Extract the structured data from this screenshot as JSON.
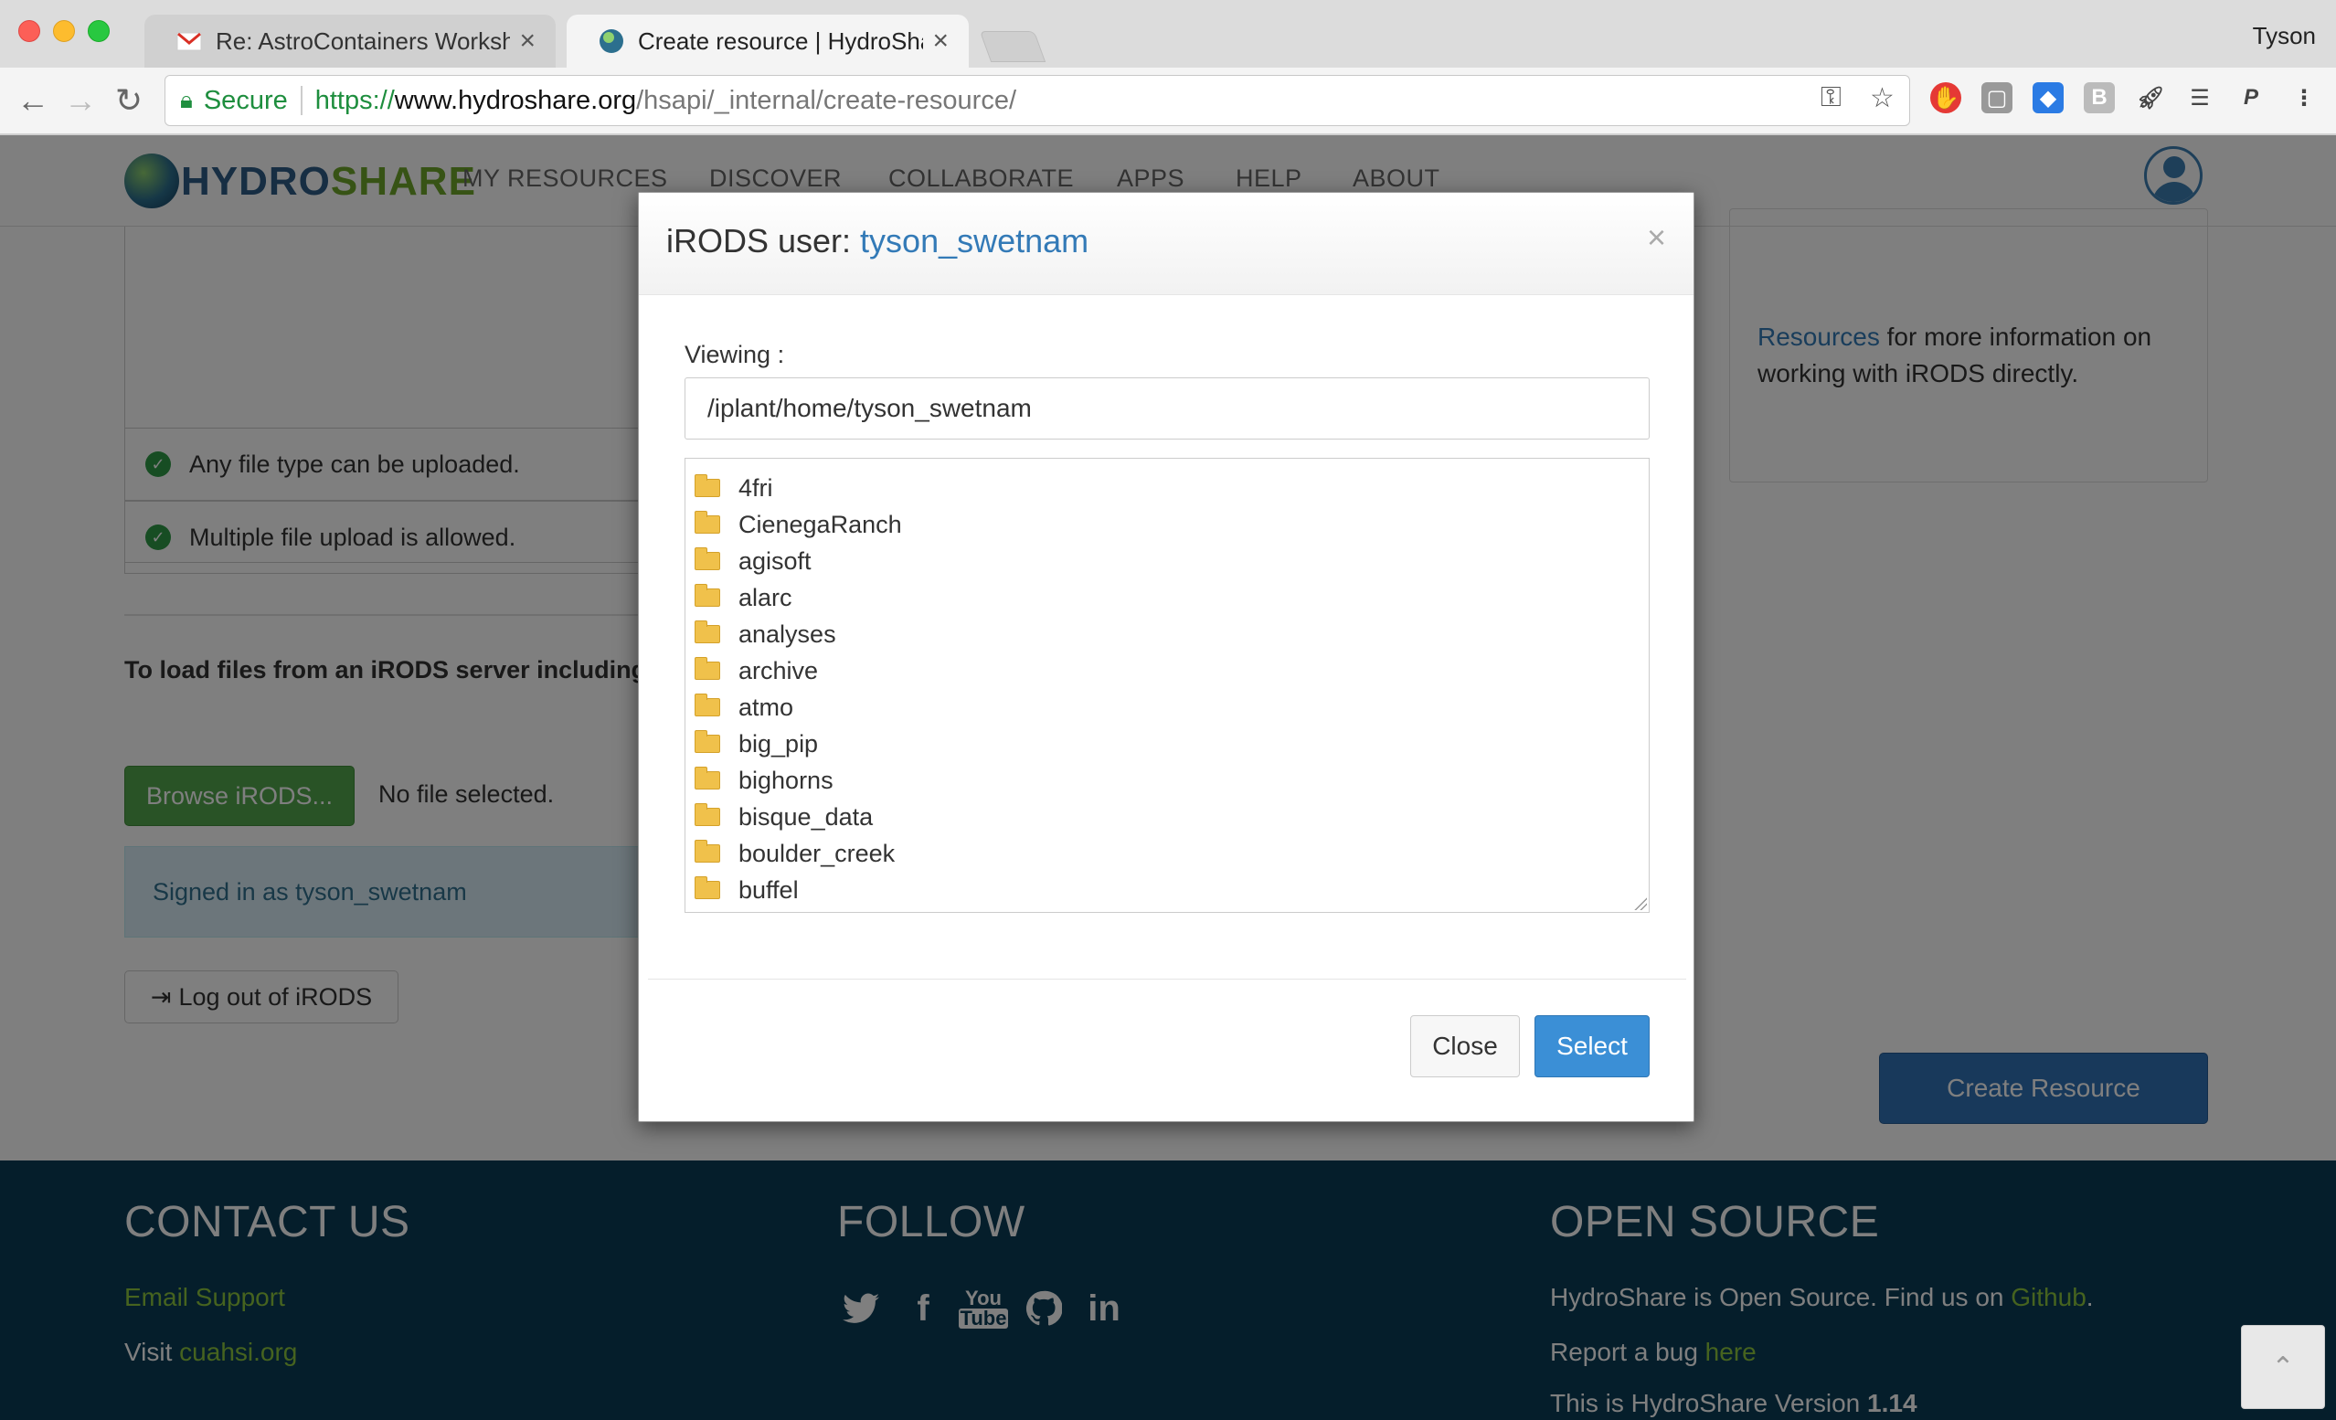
{
  "browser": {
    "tabs": [
      {
        "title": "Re: AstroContainers Workshop",
        "close": "×"
      },
      {
        "title": "Create resource | HydroShare",
        "close": "×"
      }
    ],
    "profile_name": "Tyson",
    "secure_label": "Secure",
    "url": {
      "scheme": "https://",
      "host": "www.hydroshare.org",
      "path": "/hsapi/_internal/create-resource/"
    }
  },
  "site": {
    "logo_left": "HYDRO",
    "logo_right": "SHARE",
    "nav": [
      "MY RESOURCES",
      "DISCOVER",
      "COLLABORATE",
      "APPS",
      "HELP",
      "ABOUT"
    ]
  },
  "page": {
    "features": [
      "Any file type can be uploaded.",
      "Multiple file upload is allowed."
    ],
    "irods_intro": "To load files from an iRODS server including y",
    "browse_button": "Browse iRODS...",
    "no_file": "No file selected.",
    "signed_in": "Signed in as tyson_swetnam",
    "logout_button": "Log out of iRODS",
    "help_link_partial": "Resources",
    "help_text_1": " for more information on",
    "help_text_2": "working with iRODS directly.",
    "create_button": "Create Resource"
  },
  "footer": {
    "contact_heading": "CONTACT US",
    "email_support": "Email Support",
    "visit_prefix": "Visit ",
    "visit_link": "cuahsi.org",
    "follow_heading": "FOLLOW",
    "opensource_heading": "OPEN SOURCE",
    "os_text": "HydroShare is Open Source. Find us on ",
    "os_link": "Github",
    "os_period": ".",
    "bug_prefix": "Report a bug ",
    "bug_link": "here",
    "version_prefix": "This is HydroShare Version ",
    "version": "1.14",
    "social": [
      "twitter-icon",
      "facebook-icon",
      "youtube-icon",
      "github-icon",
      "linkedin-icon"
    ]
  },
  "modal": {
    "title_prefix": "iRODS user: ",
    "user": "tyson_swetnam",
    "close_x": "×",
    "viewing_label": "Viewing :",
    "path": "/iplant/home/tyson_swetnam",
    "folders": [
      "4fri",
      "CienegaRanch",
      "agisoft",
      "alarc",
      "analyses",
      "archive",
      "atmo",
      "big_pip",
      "bighorns",
      "bisque_data",
      "boulder_creek",
      "buffel"
    ],
    "close_button": "Close",
    "select_button": "Select"
  }
}
